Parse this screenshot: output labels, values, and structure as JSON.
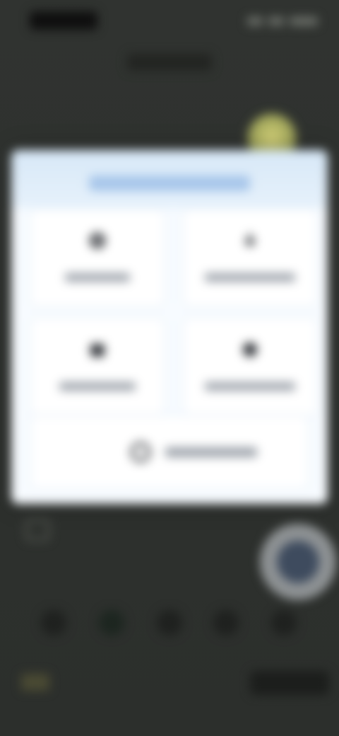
{
  "status_bar": {
    "time": "",
    "icons": [
      "signal-icon",
      "wifi-icon",
      "battery-icon"
    ]
  },
  "header": {
    "title": ""
  },
  "dialog": {
    "title": "",
    "options": [
      {
        "label": "",
        "icon": "gear-icon"
      },
      {
        "label": "",
        "icon": "download-icon"
      },
      {
        "label": "",
        "icon": "folder-icon"
      },
      {
        "label": "",
        "icon": "cloud-icon"
      }
    ],
    "wide_button": {
      "label": "",
      "icon": "refresh-icon"
    }
  },
  "colors": {
    "dialog_bg": "#f7fbff",
    "dialog_header": "#d7e8f7",
    "title_accent": "#5b86c8",
    "overlay": "#2f312e",
    "fab": "#3e4b5e"
  }
}
